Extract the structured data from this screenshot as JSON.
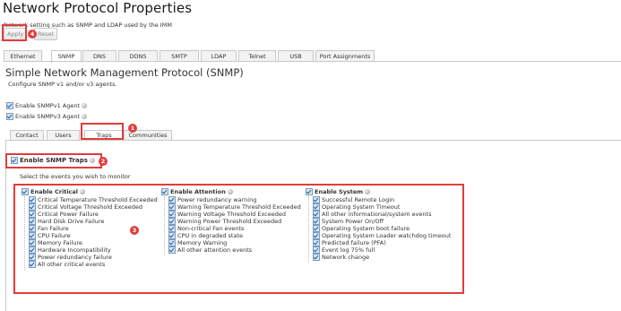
{
  "page": {
    "title": "Network Protocol Properties",
    "subtitle": "Network setting such as SNMP and LDAP used by the IMM",
    "apply_label": "Apply",
    "reset_label": "Reset"
  },
  "tabs": [
    "Ethernet",
    "SNMP",
    "DNS",
    "DDNS",
    "SMTP",
    "LDAP",
    "Telnet",
    "USB",
    "Port Assignments"
  ],
  "snmp": {
    "heading": "Simple Network Management Protocol (SNMP)",
    "description": "Configure SNMP v1 and/or v3 agents.",
    "v1_label": "Enable SNMPv1 Agent",
    "v3_label": "Enable SNMPv3 Agent"
  },
  "subtabs": [
    "Contact",
    "Users",
    "Traps",
    "Communities"
  ],
  "traps": {
    "enable_label": "Enable SNMP Traps",
    "select_text": "Select the events you wish to monitor",
    "critical": {
      "header": "Enable Critical",
      "items": [
        "Critical Temperature Threshold Exceeded",
        "Critical Voltage Threshold Exceeded",
        "Critical Power Failure",
        "Hard Disk Drive Failure",
        "Fan Failure",
        "CPU Failure",
        "Memory Failure",
        "Hardware Incompatibility",
        "Power redundancy failure",
        "All other critical events"
      ]
    },
    "attention": {
      "header": "Enable Attention",
      "items": [
        "Power redundancy warning",
        "Warning Temperature Threshold Exceeded",
        "Warning Voltage Threshold Exceeded",
        "Warning Power Threshold Exceeded",
        "Non-critical Fan events",
        "CPU in degraded state",
        "Memory Warning",
        "All other attention events"
      ]
    },
    "system": {
      "header": "Enable System",
      "items": [
        "Successful Remote Login",
        "Operating System Timeout",
        "All other informational/system events",
        "System Power On/Off",
        "Operating System boot failure",
        "Operating System Loader watchdog timeout",
        "Predicted failure (PFA)",
        "Event log 75% full",
        "Network change"
      ]
    }
  },
  "annotations": {
    "badge1": "1",
    "badge2": "2",
    "badge3": "3",
    "badge4": "4",
    "color": "#e23c3c"
  }
}
